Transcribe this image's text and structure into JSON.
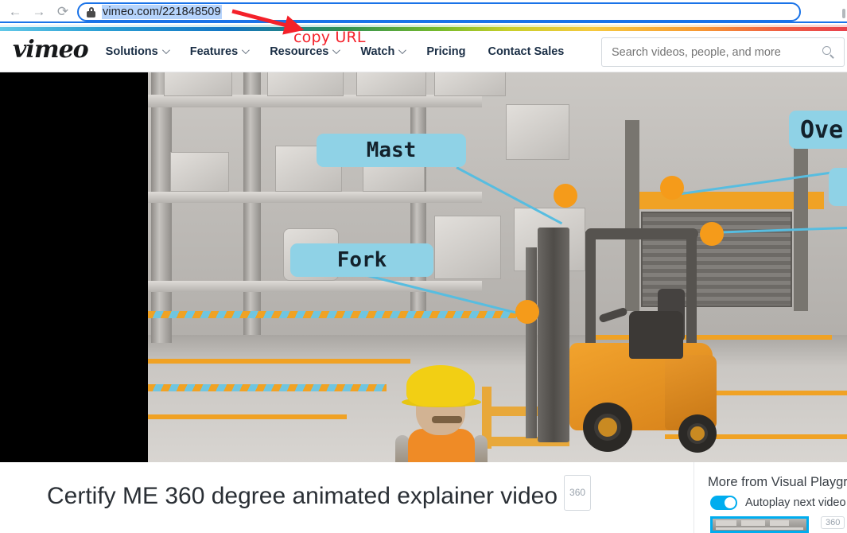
{
  "browser": {
    "back_label": "←",
    "forward_label": "→",
    "reload_label": "⟳",
    "url": "vimeo.com/221848509",
    "lock_icon": "lock-icon"
  },
  "annotation": {
    "text": "copy URL",
    "color": "#f4212a",
    "arrow_icon": "red-arrow-icon"
  },
  "site_header": {
    "logo": "vimeo",
    "nav": [
      {
        "label": "Solutions",
        "has_caret": true
      },
      {
        "label": "Features",
        "has_caret": true
      },
      {
        "label": "Resources",
        "has_caret": true
      },
      {
        "label": "Watch",
        "has_caret": true
      },
      {
        "label": "Pricing",
        "has_caret": false
      },
      {
        "label": "Contact Sales",
        "has_caret": false
      }
    ],
    "search": {
      "placeholder": "Search videos, people, and more",
      "value": "",
      "icon": "search-icon"
    }
  },
  "player": {
    "callouts": [
      {
        "label": "Mast"
      },
      {
        "label": "Fork"
      },
      {
        "label": "Ove"
      }
    ],
    "hotspot_color": "#f59b1a",
    "callout_color": "#8fd2e6",
    "line_color": "#57bde0"
  },
  "content": {
    "title": "Certify ME 360 degree animated explainer video",
    "badge": "360"
  },
  "sidebar": {
    "title": "More from Visual Playgr",
    "autoplay_label": "Autoplay next video",
    "autoplay_on": true,
    "thumb_badge": "360",
    "accent": "#00adef"
  }
}
